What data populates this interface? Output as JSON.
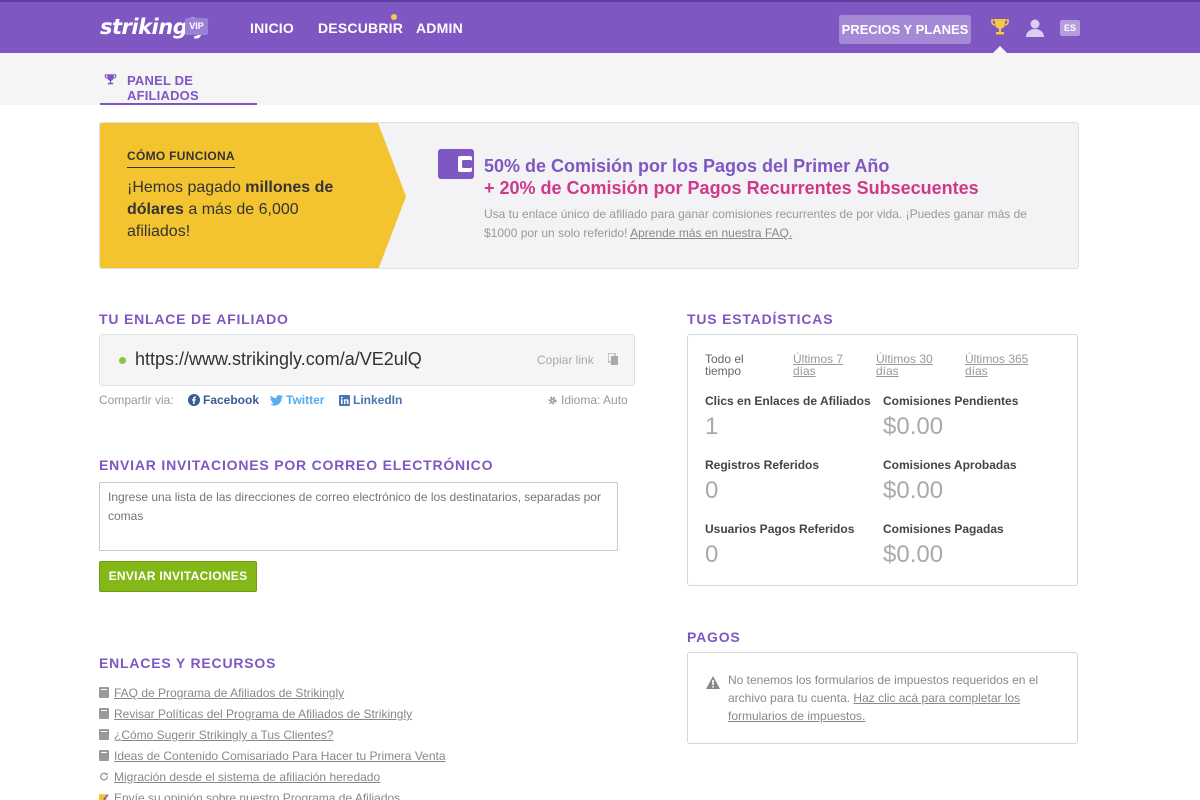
{
  "header": {
    "logo": "strikingly",
    "vip_badge": "VIP",
    "nav": [
      "INICIO",
      "DESCUBRIR",
      "ADMIN"
    ],
    "pricing_button": "PRECIOS Y PLANES",
    "language": "ES",
    "accent_color": "#7e57c2"
  },
  "subnav": {
    "tab_label": "PANEL DE AFILIADOS"
  },
  "banner": {
    "how_title": "CÓMO FUNCIONA",
    "how_text_1": "¡Hemos pagado ",
    "how_text_bold": "millones de dólares",
    "how_text_2": " a más de 6,000 afiliados!",
    "promo_line1": "50% de Comisión por los Pagos del Primer Año",
    "promo_line2": "+ 20% de Comisión por Pagos Recurrentes Subsecuentes",
    "promo_desc": "Usa tu enlace único de afiliado para ganar comisiones recurrentes de por vida. ¡Puedes ganar más de $1000 por un solo referido! ",
    "promo_link": "Aprende más en nuestra FAQ.",
    "yellow_color": "#f4c430"
  },
  "affiliate": {
    "heading": "TU ENLACE DE AFILIADO",
    "url": "https://www.strikingly.com/a/VE2ulQ",
    "copy_label": "Copiar link",
    "share_label": "Compartir via:",
    "share": [
      "Facebook",
      "Twitter",
      "LinkedIn"
    ],
    "language_setting": "Idioma: Auto"
  },
  "email": {
    "heading": "ENVIAR INVITACIONES POR CORREO ELECTRÓNICO",
    "placeholder": "Ingrese una lista de las direcciones de correo electrónico de los destinatarios, separadas por comas",
    "button": "ENVIAR INVITACIONES"
  },
  "resources": {
    "heading": "ENLACES Y RECURSOS",
    "items": [
      {
        "icon": "book-icon",
        "text": "FAQ de Programa de Afiliados de Strikingly"
      },
      {
        "icon": "book-icon",
        "text": "Revisar Políticas del Programa de Afiliados de Strikingly"
      },
      {
        "icon": "book-icon",
        "text": "¿Cómo Sugerir Strikingly a Tus Clientes?"
      },
      {
        "icon": "book-icon",
        "text": "Ideas de Contenido Comisariado Para Hacer tu Primera Venta"
      },
      {
        "icon": "refresh-icon",
        "text": "Migración desde el sistema de afiliación heredado"
      },
      {
        "icon": "pencil-icon",
        "text": "Envíe su opinión sobre nuestro Programa de Afiliados"
      }
    ]
  },
  "stats": {
    "heading": "TUS ESTADÍSTICAS",
    "tabs": [
      {
        "label": "Todo el tiempo",
        "active": true
      },
      {
        "label": "Últimos 7 días",
        "active": false
      },
      {
        "label": "Últimos 30 días",
        "active": false
      },
      {
        "label": "Últimos 365 días",
        "active": false
      }
    ],
    "clicks_label": "Clics en Enlaces de Afiliados",
    "clicks_value": "1",
    "signups_label": "Registros Referidos",
    "signups_value": "0",
    "paid_users_label": "Usuarios Pagos Referidos",
    "paid_users_value": "0",
    "pending_label": "Comisiones Pendientes",
    "pending_value": "$0.00",
    "approved_label": "Comisiones Aprobadas",
    "approved_value": "$0.00",
    "paid_label": "Comisiones Pagadas",
    "paid_value": "$0.00"
  },
  "payments": {
    "heading": "PAGOS",
    "text": "No tenemos los formularios de impuestos requeridos en el archivo para tu cuenta. ",
    "link": "Haz clic acá para completar los formularios de impuestos."
  }
}
